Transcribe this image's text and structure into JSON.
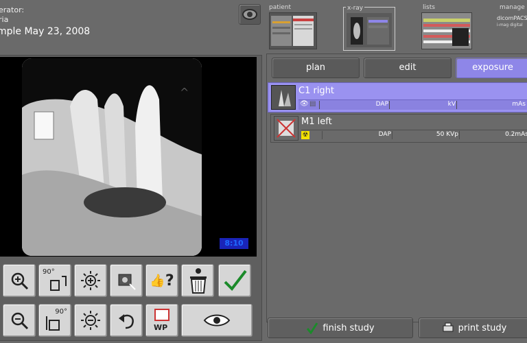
{
  "header": {
    "operator_label": "erator:",
    "operator_name": "ria",
    "sample": "mple  May 23, 2008"
  },
  "nav": {
    "patient": "patient",
    "xray": "x-ray",
    "lists": "lists",
    "manage": "manage",
    "dicom_text": "dicomPACS",
    "small_text": "i-mag digital"
  },
  "viewer": {
    "zoom_badge": "8:10",
    "corner_mark": "^"
  },
  "tabs": [
    "plan",
    "edit",
    "exposure"
  ],
  "exposures": [
    {
      "title": "C1 right",
      "dap": "DAP",
      "kv": "kV",
      "ma": "mAs"
    },
    {
      "title": "M1 left",
      "dap": "DAP",
      "kv": "50 KVp",
      "ma": "0.2mAs"
    }
  ],
  "tools": {
    "rotate_90": "90°",
    "help": "?",
    "wp": "WP"
  },
  "buttons": {
    "finish": "finish study",
    "print": "print study"
  },
  "colors": {
    "accent": "#8e86e8",
    "selected_row": "#9a92f0",
    "zoom_badge": "#1a24b8"
  }
}
